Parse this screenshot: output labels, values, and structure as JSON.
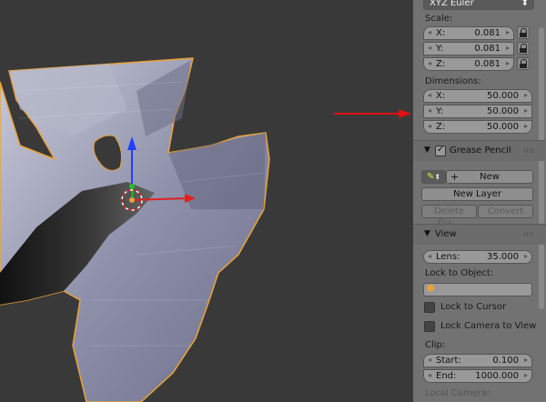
{
  "panel": {
    "rotation_mode": "XYZ Euler",
    "scale": {
      "label": "Scale:",
      "x_key": "X:",
      "x_val": "0.081",
      "y_key": "Y:",
      "y_val": "0.081",
      "z_key": "Z:",
      "z_val": "0.081"
    },
    "dimensions": {
      "label": "Dimensions:",
      "x_key": "X:",
      "x_val": "50.000",
      "y_key": "Y:",
      "y_val": "50.000",
      "z_key": "Z:",
      "z_val": "50.000"
    },
    "grease_pencil": {
      "title": "Grease Pencil",
      "new_label": "New",
      "new_layer_label": "New Layer",
      "delete_frame_label": "Delete Fra...",
      "convert_label": "Convert"
    },
    "view": {
      "title": "View",
      "lens_key": "Lens:",
      "lens_val": "35.000",
      "lock_to_object_label": "Lock to Object:",
      "lock_to_cursor_label": "Lock to Cursor",
      "lock_camera_label": "Lock Camera to View",
      "clip_label": "Clip:",
      "start_key": "Start:",
      "start_val": "0.100",
      "end_key": "End:",
      "end_val": "1000.000",
      "local_camera_label": "Local Camera:"
    }
  },
  "colors": {
    "selection_outline": "#e8a23a",
    "annotation_arrow": "#e01010",
    "axis_x": "#e02020",
    "axis_z": "#2040ff",
    "mesh_fill": "#8a8ca8"
  },
  "icons": [
    "dropdown-icon",
    "lock-icon",
    "check-icon",
    "pencil-icon",
    "plus-icon",
    "cube-icon",
    "triangle-down-icon",
    "grip-icon"
  ]
}
